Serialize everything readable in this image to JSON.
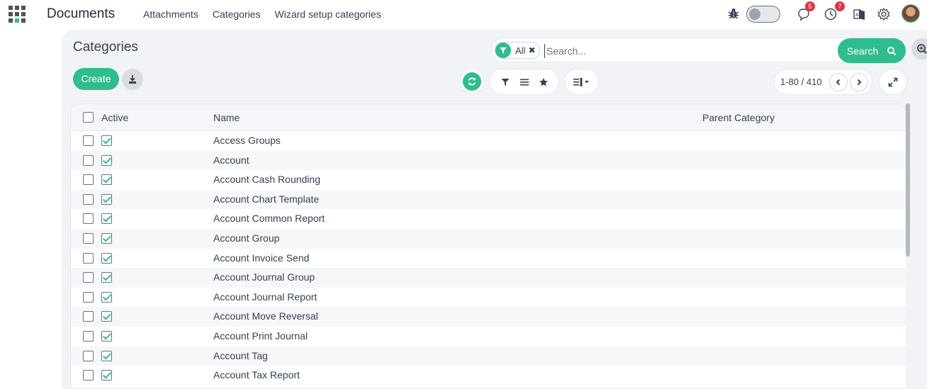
{
  "navbar": {
    "app_title": "Documents",
    "menu": [
      "Attachments",
      "Categories",
      "Wizard setup categories"
    ],
    "messages_count": "5",
    "activities_count": "7",
    "icons": [
      "apps-grid-icon",
      "bug-icon",
      "chat-icon",
      "clock-icon",
      "language-icon",
      "gear-icon"
    ]
  },
  "page": {
    "title": "Categories",
    "create_label": "Create"
  },
  "search": {
    "facet_label": "All",
    "placeholder": "Search...",
    "button_label": "Search"
  },
  "pager": {
    "range": "1-80 / 410"
  },
  "list": {
    "columns": [
      "Active",
      "Name",
      "Parent Category"
    ],
    "rows": [
      {
        "active": true,
        "name": "Access Groups",
        "parent": ""
      },
      {
        "active": true,
        "name": "Account",
        "parent": ""
      },
      {
        "active": true,
        "name": "Account Cash Rounding",
        "parent": ""
      },
      {
        "active": true,
        "name": "Account Chart Template",
        "parent": ""
      },
      {
        "active": true,
        "name": "Account Common Report",
        "parent": ""
      },
      {
        "active": true,
        "name": "Account Group",
        "parent": ""
      },
      {
        "active": true,
        "name": "Account Invoice Send",
        "parent": ""
      },
      {
        "active": true,
        "name": "Account Journal Group",
        "parent": ""
      },
      {
        "active": true,
        "name": "Account Journal Report",
        "parent": ""
      },
      {
        "active": true,
        "name": "Account Move Reversal",
        "parent": ""
      },
      {
        "active": true,
        "name": "Account Print Journal",
        "parent": ""
      },
      {
        "active": true,
        "name": "Account Tag",
        "parent": ""
      },
      {
        "active": true,
        "name": "Account Tax Report",
        "parent": ""
      }
    ]
  },
  "colors": {
    "accent": "#2ebd8d",
    "badge": "#dc3545",
    "panel": "#f1f3f6"
  }
}
